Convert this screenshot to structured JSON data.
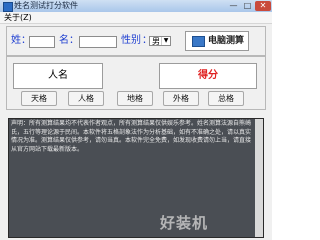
{
  "window": {
    "title": "姓名测试打分软件"
  },
  "controls": {
    "min": "—",
    "max": "□",
    "close": "✕"
  },
  "menu": {
    "about": "关于(Z)"
  },
  "form": {
    "surname_label": "姓",
    "given_label": "名",
    "gender_label": "性别",
    "gender_value": "男",
    "surname_value": "",
    "given_value": "",
    "calc_button": "电脑测算"
  },
  "display": {
    "name_label": "人名",
    "result_label": "得分"
  },
  "buttons": [
    "天格",
    "人格",
    "地格",
    "外格",
    "总格"
  ],
  "description": "声明：所有测算结果均不代表作者观点，所有测算结果仅供娱乐参考。姓名测算法源自熊崎氏，五行等理论源于民间。本软件将五格剖象法作为分析基础，如有不准确之处，请以真实情况为准。测算结果仅供参考，请勿当真。本软件完全免费，如发现收费请勿上当，请直接从官方网站下载最新版本。",
  "watermark": "好装机"
}
